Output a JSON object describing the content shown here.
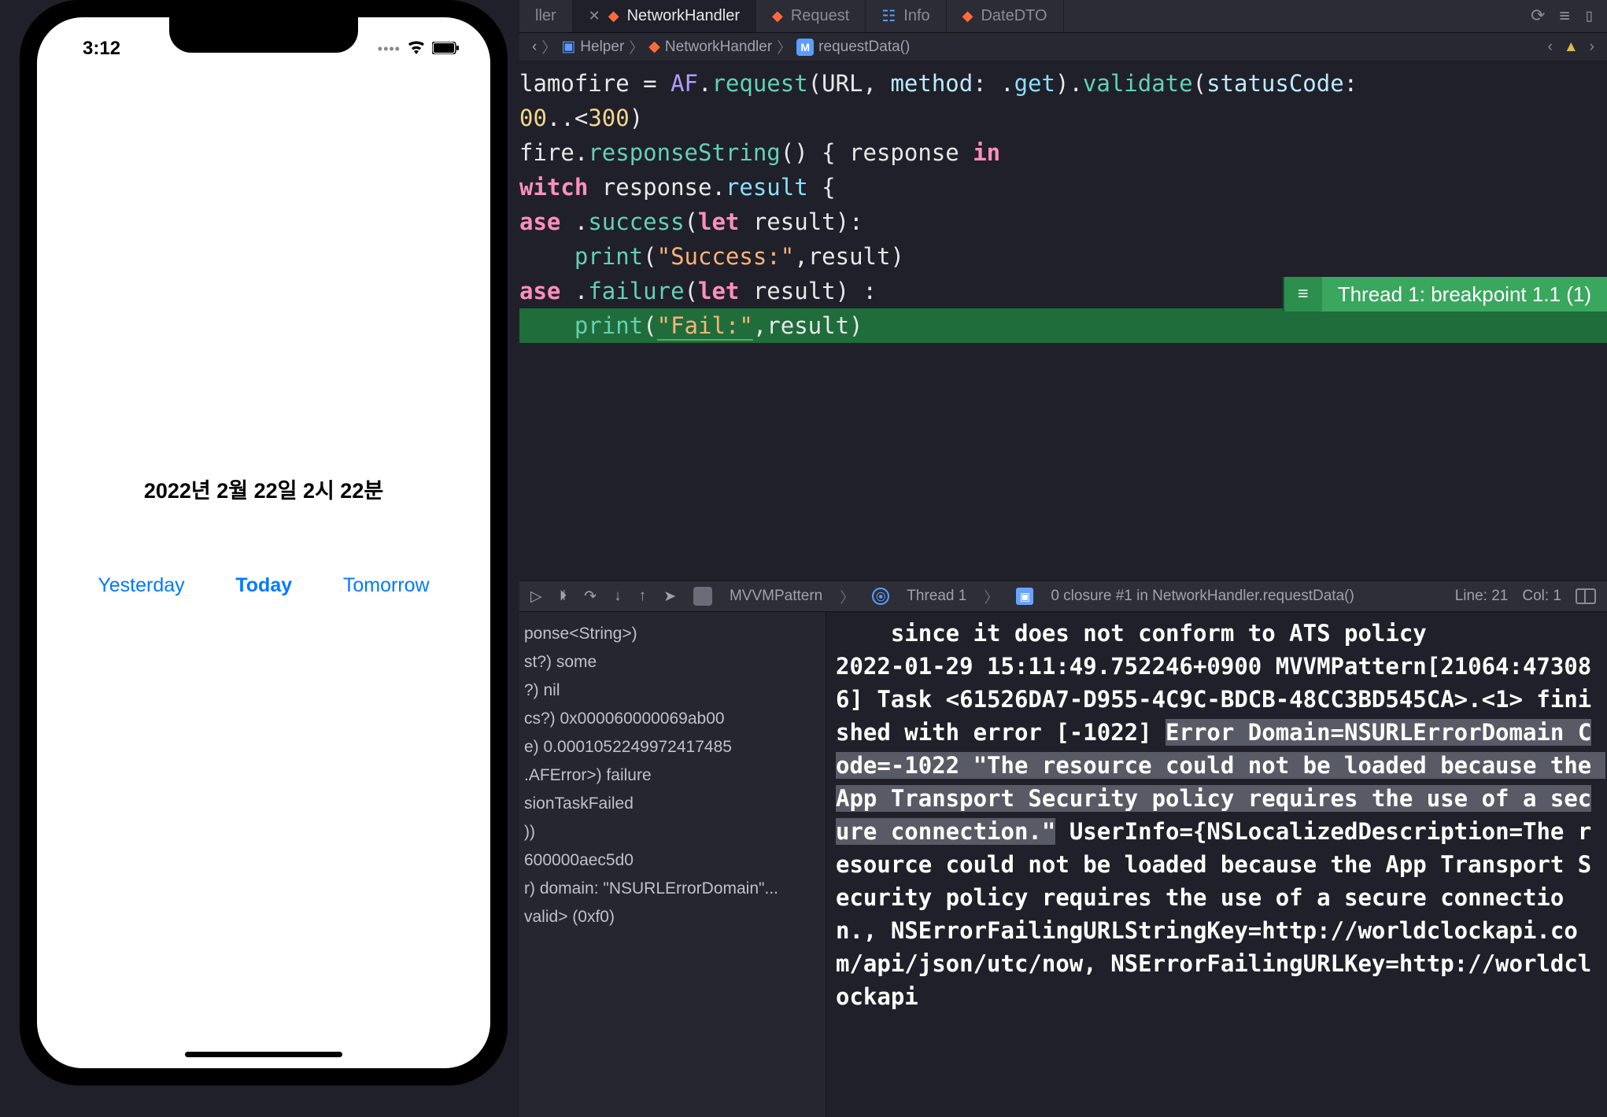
{
  "simulator": {
    "time": "3:12",
    "date_label": "2022년 2월 22일 2시 22분",
    "buttons": {
      "yesterday": "Yesterday",
      "today": "Today",
      "tomorrow": "Tomorrow"
    }
  },
  "tabs": {
    "left_partial": "ller",
    "active": "NetworkHandler",
    "t2": "Request",
    "t3": "Info",
    "t4": "DateDTO"
  },
  "breadcrumb": {
    "seg1": "Helper",
    "seg2": "NetworkHandler",
    "seg3": "requestData()"
  },
  "code": {
    "l1a": "lamofire = ",
    "l1b": "AF",
    "l1c": ".",
    "l1d": "request",
    "l1e": "(URL, ",
    "l1f": "method",
    "l1g": ": .",
    "l1h": "get",
    "l1i": ").",
    "l1j": "validate",
    "l1k": "(",
    "l1l": "statusCode",
    "l1m": ":",
    "l2a": "00",
    "l2b": "..<",
    "l2c": "300",
    "l2d": ")",
    "l3a": "fire.",
    "l3b": "responseString",
    "l3c": "() { response ",
    "l3d": "in",
    "l4a": "witch",
    "l4b": " response.",
    "l4c": "result",
    "l4d": " {",
    "l5a": "ase",
    "l5b": " .",
    "l5c": "success",
    "l5d": "(",
    "l5e": "let",
    "l5f": " result):",
    "l6a": "    ",
    "l6b": "print",
    "l6c": "(",
    "l6d": "\"Success:\"",
    "l6e": ",result)",
    "l7a": "ase",
    "l7b": " .",
    "l7c": "failure",
    "l7d": "(",
    "l7e": "let",
    "l7f": " result) :",
    "l8a": "    ",
    "l8b": "print",
    "l8c": "(",
    "l8d": "\"Fail:\"",
    "l8e": ",result)"
  },
  "breakpoint": {
    "label": "Thread 1: breakpoint 1.1 (1)",
    "handle": "≡"
  },
  "debug_bar": {
    "app": "MVVMPattern",
    "thread": "Thread 1",
    "frame": "0 closure #1 in NetworkHandler.requestData()",
    "line": "Line: 21",
    "col": "Col: 1"
  },
  "vars": {
    "v0": "ponse<String>)",
    "v1": "st?) some",
    "v2": "?) nil",
    "v3": " ",
    "v4": "cs?) 0x000060000069ab00",
    "v5": "e) 0.0001052249972417485",
    "v6": ".AFError>) failure",
    "v7": "sionTaskFailed",
    "v8": "))",
    "v9": "600000aec5d0",
    "v10": "r) domain: \"NSURLErrorDomain\"...",
    "v11": "valid> (0xf0)"
  },
  "console": {
    "pre": "    since it does not conform to ATS policy\n2022-01-29 15:11:49.752246+0900 MVVMPattern[21064:473086] Task <61526DA7-D955-4C9C-BDCB-48CC3BD545CA>.<1> finished with error [-1022] ",
    "sel": "Error Domain=NSURLErrorDomain Code=-1022 \"The resource could not be loaded because the App Transport Security policy requires the use of a secure connection.\"",
    "post": " UserInfo={NSLocalizedDescription=The resource could not be loaded because the App Transport Security policy requires the use of a secure connection., NSErrorFailingURLStringKey=http://worldclockapi.com/api/json/utc/now, NSErrorFailingURLKey=http://worldclockapi"
  }
}
